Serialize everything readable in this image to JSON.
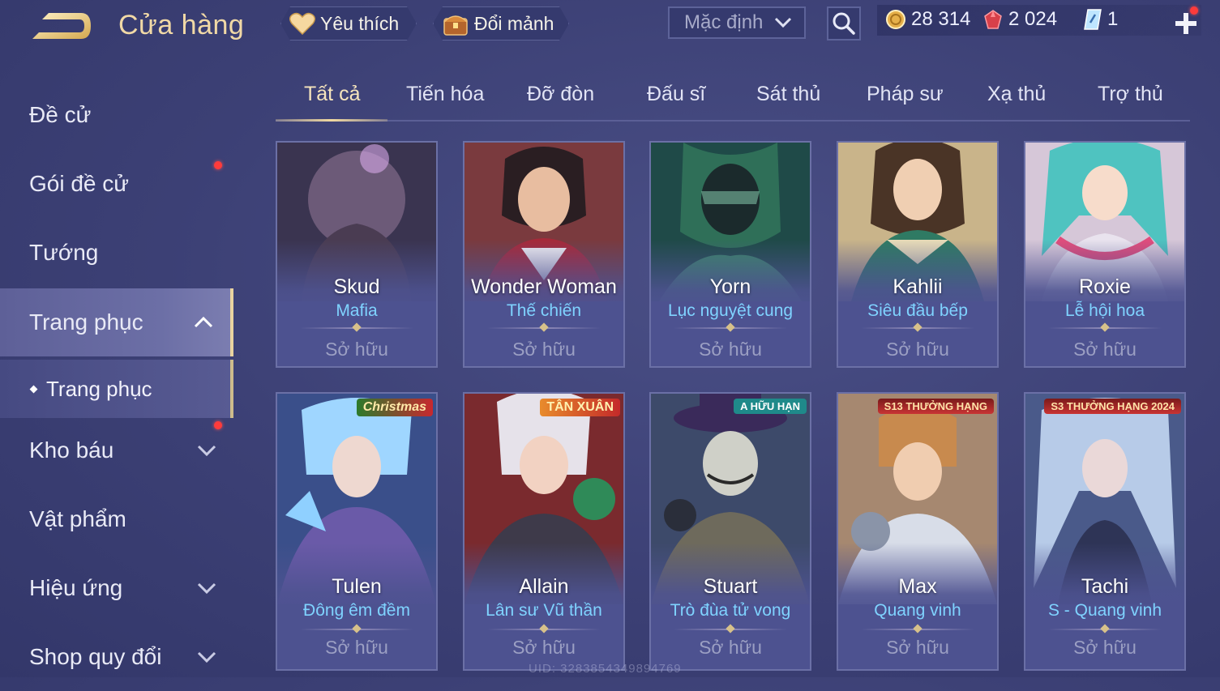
{
  "header": {
    "title": "Cửa hàng",
    "favorites_label": "Yêu thích",
    "exchange_label": "Đổi mảnh",
    "sort_selected": "Mặc định"
  },
  "currencies": [
    {
      "icon": "gold-coin-icon",
      "value": "28 314"
    },
    {
      "icon": "red-gem-icon",
      "value": "2 024"
    },
    {
      "icon": "crystal-voucher-icon",
      "value": "1"
    }
  ],
  "sidebar": {
    "items": [
      {
        "label": "Đề cử"
      },
      {
        "label": "Gói đề cử"
      },
      {
        "label": "Tướng"
      },
      {
        "label": "Trang phục"
      },
      {
        "label": "Trang phục"
      },
      {
        "label": "Kho báu"
      },
      {
        "label": "Vật phẩm"
      },
      {
        "label": "Hiệu ứng"
      },
      {
        "label": "Shop quy đổi"
      }
    ]
  },
  "tabs": [
    {
      "label": "Tất cả"
    },
    {
      "label": "Tiến hóa"
    },
    {
      "label": "Đỡ đòn"
    },
    {
      "label": "Đấu sĩ"
    },
    {
      "label": "Sát thủ"
    },
    {
      "label": "Pháp sư"
    },
    {
      "label": "Xạ thủ"
    },
    {
      "label": "Trợ thủ"
    }
  ],
  "skins": [
    {
      "hero": "Skud",
      "skin": "Mafia",
      "status": "Sở hữu"
    },
    {
      "hero": "Wonder Woman",
      "skin": "Thế chiến",
      "status": "Sở hữu"
    },
    {
      "hero": "Yorn",
      "skin": "Lục nguyệt cung",
      "status": "Sở hữu"
    },
    {
      "hero": "Kahlii",
      "skin": "Siêu đầu bếp",
      "status": "Sở hữu"
    },
    {
      "hero": "Roxie",
      "skin": "Lễ hội hoa",
      "status": "Sở hữu"
    },
    {
      "hero": "Tulen",
      "skin": "Đông êm đềm",
      "status": "Sở hữu",
      "badge": "Christmas"
    },
    {
      "hero": "Allain",
      "skin": "Lân sư Vũ thần",
      "status": "Sở hữu",
      "badge": "TÂN XUÂN"
    },
    {
      "hero": "Stuart",
      "skin": "Trò đùa tử vong",
      "status": "Sở hữu",
      "badge": "A HỮU HẠN"
    },
    {
      "hero": "Max",
      "skin": "Quang vinh",
      "status": "Sở hữu",
      "badge": "S13 THƯỞNG HẠNG"
    },
    {
      "hero": "Tachi",
      "skin": "S - Quang vinh",
      "status": "Sở hữu",
      "badge": "S3 THƯỞNG HẠNG 2024"
    }
  ],
  "footer": {
    "uid": "UID: 3283854349894769"
  },
  "colors": {
    "accent_gold": "#f1d9a6",
    "skin_name": "#7fd3ff",
    "notification": "#ff3b3b"
  }
}
